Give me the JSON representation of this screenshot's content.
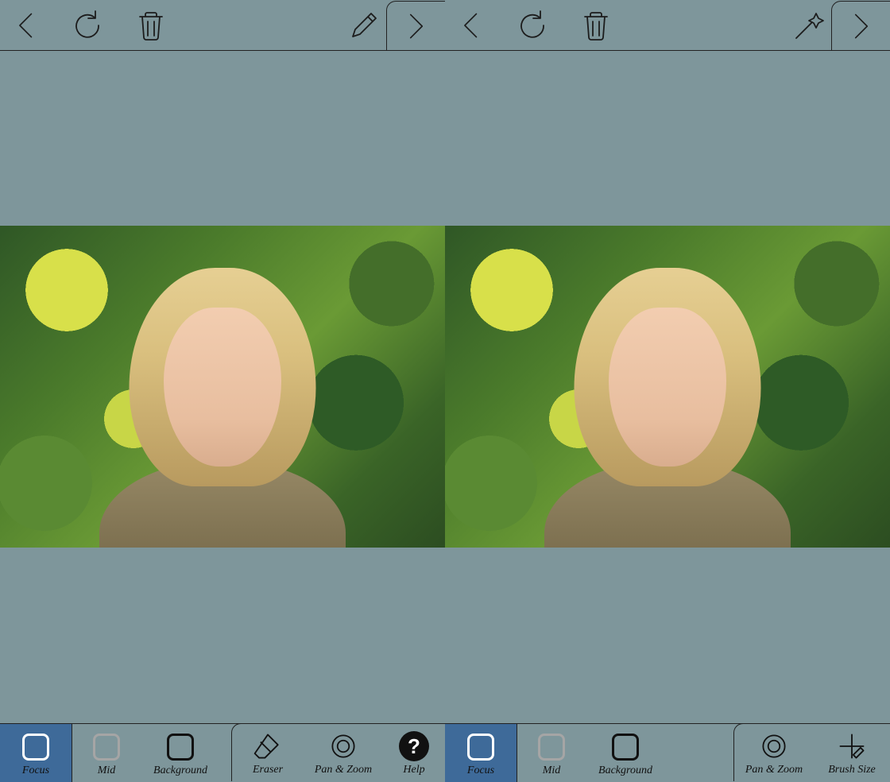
{
  "panels": [
    {
      "top_mode_icon": "pencil",
      "bottom": {
        "selected": 0,
        "depth": [
          {
            "label": "Focus",
            "swatch": "white"
          },
          {
            "label": "Mid",
            "swatch": "grey"
          },
          {
            "label": "Background",
            "swatch": "black"
          }
        ],
        "tools": [
          {
            "label": "Eraser",
            "icon": "eraser"
          },
          {
            "label": "Pan & Zoom",
            "icon": "panzoom"
          },
          {
            "label": "Help",
            "icon": "help"
          }
        ]
      }
    },
    {
      "top_mode_icon": "wand",
      "bottom": {
        "selected": 0,
        "depth": [
          {
            "label": "Focus",
            "swatch": "white"
          },
          {
            "label": "Mid",
            "swatch": "grey"
          },
          {
            "label": "Background",
            "swatch": "black"
          }
        ],
        "tools": [
          {
            "label": "Pan & Zoom",
            "icon": "panzoom"
          },
          {
            "label": "Brush Size",
            "icon": "brushsize"
          }
        ]
      }
    }
  ],
  "icon_names": {
    "back": "chevron-left-icon",
    "undo": "undo-icon",
    "trash": "trash-icon",
    "pencil": "pencil-icon",
    "wand": "magic-wand-icon",
    "next": "chevron-right-icon",
    "eraser": "eraser-icon",
    "panzoom": "pan-zoom-icon",
    "help": "help-icon",
    "brushsize": "brush-size-icon"
  }
}
